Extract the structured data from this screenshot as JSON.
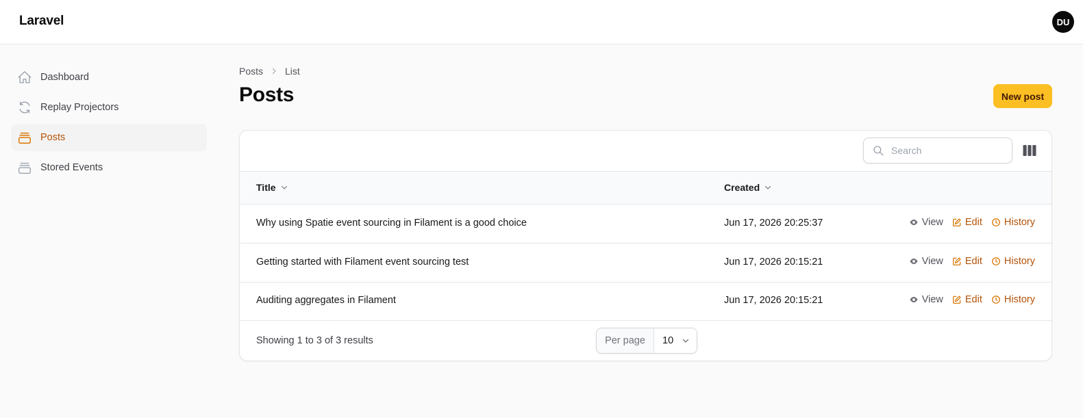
{
  "app": {
    "brand": "Laravel",
    "avatar_initials": "DU"
  },
  "sidebar": {
    "items": [
      {
        "label": "Dashboard",
        "icon": "home-icon",
        "active": false
      },
      {
        "label": "Replay Projectors",
        "icon": "refresh-icon",
        "active": false
      },
      {
        "label": "Posts",
        "icon": "stack-icon",
        "active": true
      },
      {
        "label": "Stored Events",
        "icon": "stack-icon",
        "active": false
      }
    ]
  },
  "breadcrumb": {
    "items": [
      "Posts",
      "List"
    ]
  },
  "page": {
    "title": "Posts",
    "new_button_label": "New post"
  },
  "search": {
    "placeholder": "Search",
    "value": ""
  },
  "table": {
    "columns": [
      "Title",
      "Created"
    ],
    "rows": [
      {
        "title": "Why using Spatie event sourcing in Filament is a good choice",
        "created": "Jun 17, 2026 20:25:37"
      },
      {
        "title": "Getting started with Filament event sourcing test",
        "created": "Jun 17, 2026 20:15:21"
      },
      {
        "title": "Auditing aggregates in Filament",
        "created": "Jun 17, 2026 20:15:21"
      }
    ],
    "actions": {
      "view": "View",
      "edit": "Edit",
      "history": "History"
    }
  },
  "pagination": {
    "summary": "Showing 1 to 3 of 3 results",
    "per_page_label": "Per page",
    "per_page_value": "10"
  },
  "colors": {
    "accent": "#b45309",
    "primary_button": "#fbbf24",
    "background": "#fafafa",
    "active_nav_bg": "#f3f3f3"
  }
}
